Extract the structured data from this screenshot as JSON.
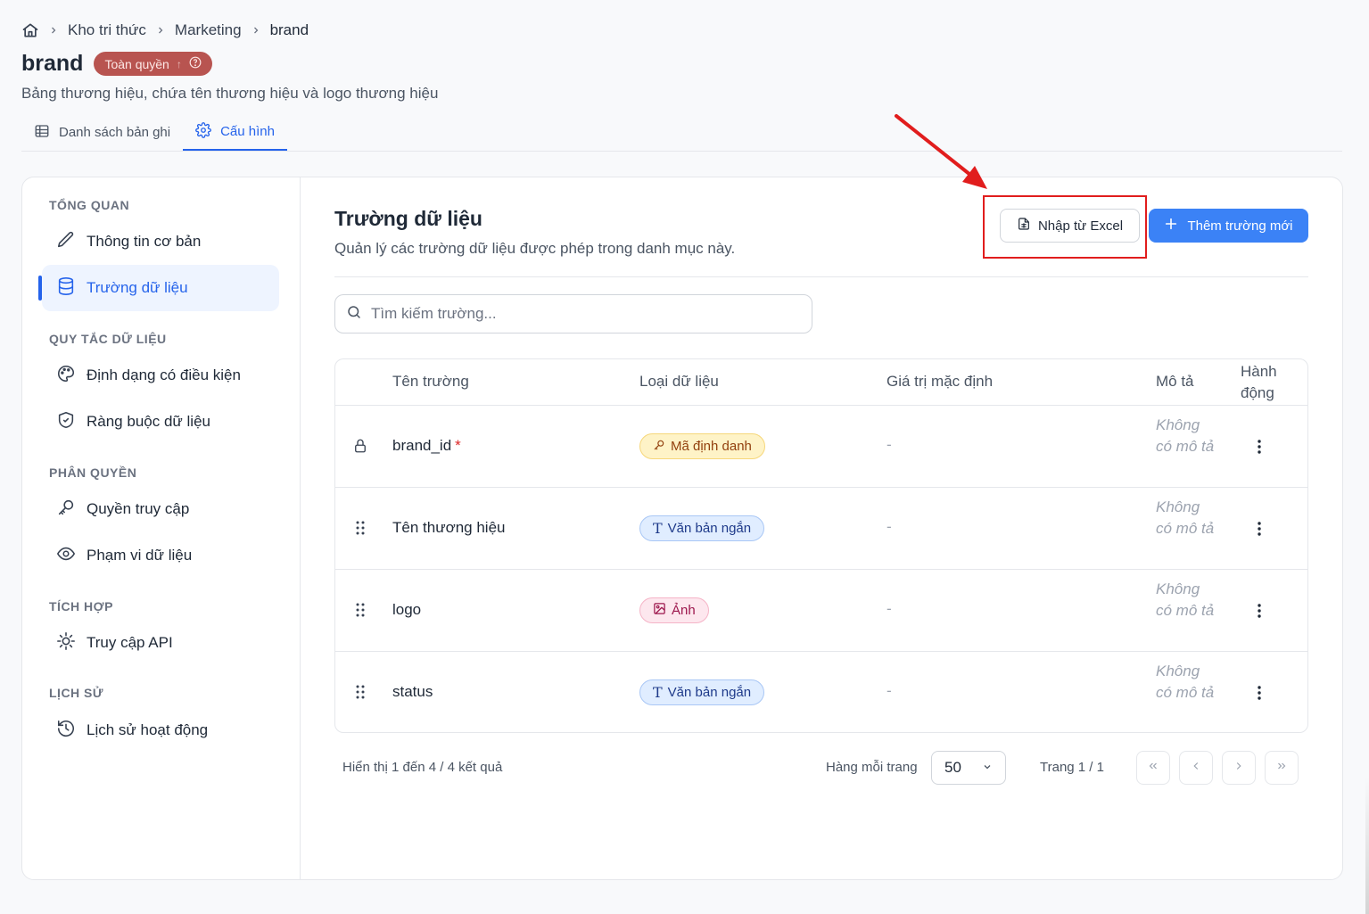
{
  "breadcrumb": {
    "items": [
      "Kho tri thức",
      "Marketing",
      "brand"
    ]
  },
  "header": {
    "title": "brand",
    "badge": "Toàn quyền",
    "subtitle": "Bảng thương hiệu, chứa tên thương hiệu và logo thương hiệu"
  },
  "tabs": [
    {
      "label": "Danh sách bản ghi",
      "icon": "table-icon",
      "active": false
    },
    {
      "label": "Cấu hình",
      "icon": "gear-icon",
      "active": true
    }
  ],
  "sidebar": {
    "sections": [
      {
        "heading": "TỔNG QUAN",
        "items": [
          {
            "label": "Thông tin cơ bản",
            "icon": "pencil-icon"
          },
          {
            "label": "Trường dữ liệu",
            "icon": "database-icon",
            "active": true
          }
        ]
      },
      {
        "heading": "QUY TẮC DỮ LIỆU",
        "items": [
          {
            "label": "Định dạng có điều kiện",
            "icon": "palette-icon"
          },
          {
            "label": "Ràng buộc dữ liệu",
            "icon": "shield-icon"
          }
        ]
      },
      {
        "heading": "PHÂN QUYỀN",
        "items": [
          {
            "label": "Quyền truy cập",
            "icon": "key-icon"
          },
          {
            "label": "Phạm vi dữ liệu",
            "icon": "eye-icon"
          }
        ]
      },
      {
        "heading": "TÍCH HỢP",
        "items": [
          {
            "label": "Truy cập API",
            "icon": "api-icon"
          }
        ]
      },
      {
        "heading": "LỊCH SỬ",
        "items": [
          {
            "label": "Lịch sử hoạt động",
            "icon": "history-icon"
          }
        ]
      }
    ]
  },
  "main": {
    "title": "Trường dữ liệu",
    "description": "Quản lý các trường dữ liệu được phép trong danh mục này.",
    "import_button": "Nhập từ Excel",
    "add_button": "Thêm trường mới",
    "search_placeholder": "Tìm kiếm trường..."
  },
  "table": {
    "columns": [
      "Tên trường",
      "Loại dữ liệu",
      "Giá trị mặc định",
      "Mô tả",
      "Hành động"
    ],
    "rows": [
      {
        "name": "brand_id",
        "required": "*",
        "lead_icon": "lock-icon",
        "type": "Mã định danh",
        "type_icon": "key-icon",
        "type_color": "yellow",
        "default": "-",
        "description": "Không có mô tả"
      },
      {
        "name": "Tên thương hiệu",
        "required": "",
        "lead_icon": "drag-handle-icon",
        "type": "Văn bản ngắn",
        "type_icon": "text-icon",
        "type_color": "blue",
        "default": "-",
        "description": "Không có mô tả"
      },
      {
        "name": "logo",
        "required": "",
        "lead_icon": "drag-handle-icon",
        "type": "Ảnh",
        "type_icon": "image-icon",
        "type_color": "pink",
        "default": "-",
        "description": "Không có mô tả"
      },
      {
        "name": "status",
        "required": "",
        "lead_icon": "drag-handle-icon",
        "type": "Văn bản ngắn",
        "type_icon": "text-icon",
        "type_color": "blue",
        "default": "-",
        "description": "Không có mô tả"
      }
    ]
  },
  "footer": {
    "showing": "Hiển thị 1 đến 4 / 4 kết quả",
    "rows_per_page_label": "Hàng mỗi trang",
    "rows_per_page_value": "50",
    "page_label": "Trang 1 / 1"
  },
  "colors": {
    "accent": "#2563eb",
    "primary_button": "#3b82f6",
    "badge": "#b85450",
    "annotation": "#e11d1d"
  }
}
